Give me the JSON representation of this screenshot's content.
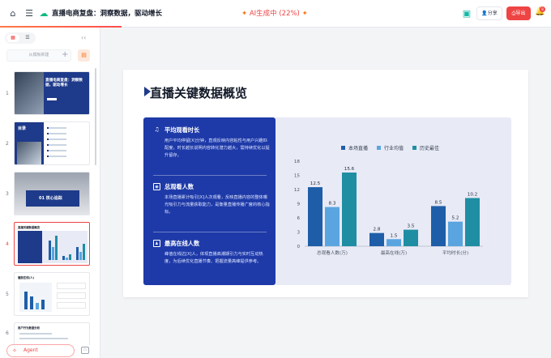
{
  "topbar": {
    "doc_title": "直播电商复盘：洞察数据，驱动增长",
    "ai_status": "AI生成中 (22%)",
    "ai_progress": 0.22,
    "share_label": "分享",
    "export_label": "导出",
    "notification_count": "8",
    "icons": [
      "home-icon",
      "menu-icon",
      "cloud-saved-icon",
      "search-icon",
      "sparkle-icon",
      "app-icon",
      "bell-icon"
    ]
  },
  "sidebar": {
    "add_placeholder": "从模板新建",
    "agent_placeholder": "Agent",
    "slides": [
      {
        "number": "1",
        "title": "直播电商复盘：洞察数据，驱动增长"
      },
      {
        "number": "2",
        "title": "目录"
      },
      {
        "number": "3",
        "title": "01 核心追踪"
      },
      {
        "number": "4",
        "title": "直播关键数据概览"
      },
      {
        "number": "5",
        "title": "播放在线(人)"
      },
      {
        "number": "6",
        "title": "用户行为数据分析"
      }
    ]
  },
  "slide": {
    "title": "直播关键数据概览",
    "metrics": [
      {
        "icon": "music-note-icon",
        "title": "平均观看时长",
        "body": "用户平均停留[X]分钟，直观反映内容粘性与用户兴趣匹配度，时长越长说明内容转化潜力越大，需持续优化以提升留存。"
      },
      {
        "icon": "eye-icon",
        "title": "总观看人数",
        "body": "本场直播累计吸引[X]人次观看，反映直播内容的整体曝光吸引力与流量获取能力，是衡量直播传播广度的核心指标。"
      },
      {
        "icon": "users-icon",
        "title": "最高在线人数",
        "body": "峰值在线达[X]人，体现直播高潮期引力与实时互动热度，为后续优化直播节奏、把握流量高峰提供参考。"
      }
    ]
  },
  "chart_data": {
    "type": "bar",
    "categories": [
      "总观看人数(万)",
      "最高在线(万)",
      "平均时长(分)"
    ],
    "series": [
      {
        "name": "本场直播",
        "values": [
          12.5,
          2.8,
          8.5
        ],
        "color": "#1e5ea8"
      },
      {
        "name": "行业均值",
        "values": [
          8.3,
          1.5,
          5.2
        ],
        "color": "#5aa5e0"
      },
      {
        "name": "历史最佳",
        "values": [
          15.6,
          3.5,
          10.2
        ],
        "color": "#1f8ea3"
      }
    ],
    "yticks": [
      0,
      3,
      6,
      9,
      12,
      15,
      18
    ],
    "ylim": [
      0,
      18
    ],
    "legend": "top",
    "grid": false
  }
}
